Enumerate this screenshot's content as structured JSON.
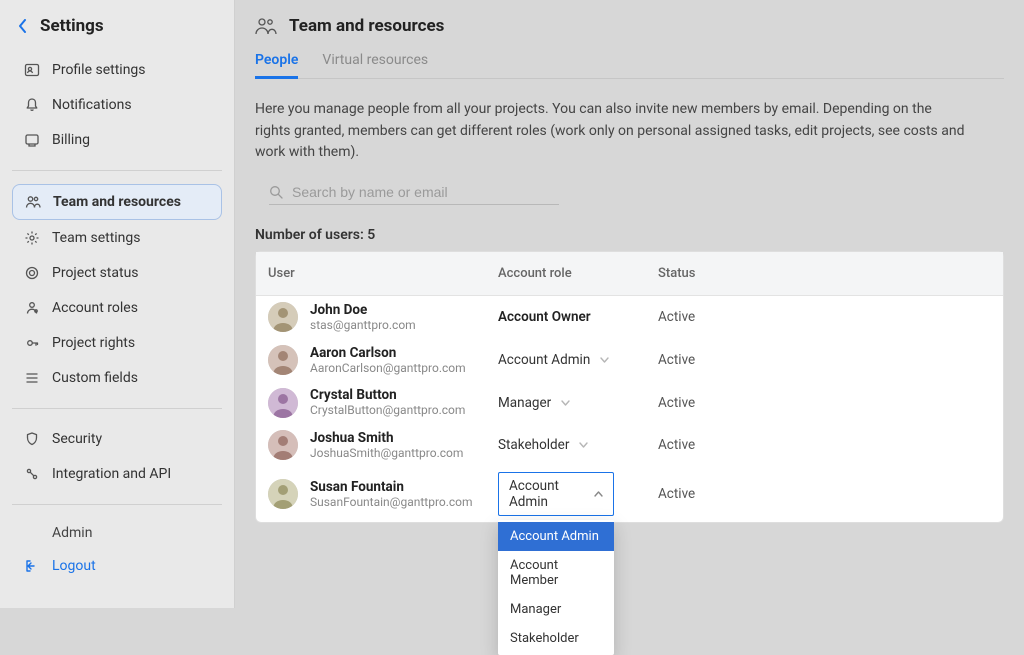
{
  "sidebar": {
    "title": "Settings",
    "items": [
      {
        "label": "Profile settings",
        "icon": "user-card-icon"
      },
      {
        "label": "Notifications",
        "icon": "bell-icon"
      },
      {
        "label": "Billing",
        "icon": "billing-icon"
      }
    ],
    "items2": [
      {
        "label": "Team and resources",
        "icon": "people-icon",
        "active": true
      },
      {
        "label": "Team settings",
        "icon": "gear-icon"
      },
      {
        "label": "Project status",
        "icon": "target-icon"
      },
      {
        "label": "Account roles",
        "icon": "roles-icon"
      },
      {
        "label": "Project rights",
        "icon": "rights-icon"
      },
      {
        "label": "Custom fields",
        "icon": "list-icon"
      }
    ],
    "items3": [
      {
        "label": "Security",
        "icon": "shield-icon"
      },
      {
        "label": "Integration and API",
        "icon": "api-icon"
      }
    ],
    "plain_label": "Admin",
    "logout": {
      "label": "Logout",
      "icon": "logout-icon"
    }
  },
  "header": {
    "title": "Team and resources",
    "icon": "people-icon"
  },
  "tabs": [
    {
      "label": "People",
      "active": true
    },
    {
      "label": "Virtual resources",
      "active": false
    }
  ],
  "intro": "Here you manage people from all your projects. You can also invite new members by email. Depending on the rights granted, members can get different roles (work only on personal assigned tasks, edit projects, see costs and work with them).",
  "search": {
    "placeholder": "Search by name or email",
    "value": ""
  },
  "usercount": {
    "label": "Number of users:",
    "value": "5"
  },
  "table": {
    "columns": {
      "user": "User",
      "role": "Account role",
      "status": "Status"
    },
    "rows": [
      {
        "name": "John Doe",
        "email": "stas@ganttpro.com",
        "role": "Account Owner",
        "editable": false,
        "open": false,
        "status": "Active"
      },
      {
        "name": "Aaron Carlson",
        "email": "AaronCarlson@ganttpro.com",
        "role": "Account Admin",
        "editable": true,
        "open": false,
        "status": "Active"
      },
      {
        "name": "Crystal Button",
        "email": "CrystalButton@ganttpro.com",
        "role": "Manager",
        "editable": true,
        "open": false,
        "status": "Active"
      },
      {
        "name": "Joshua Smith",
        "email": "JoshuaSmith@ganttpro.com",
        "role": "Stakeholder",
        "editable": true,
        "open": false,
        "status": "Active"
      },
      {
        "name": "Susan Fountain",
        "email": "SusanFountain@ganttpro.com",
        "role": "Account Admin",
        "editable": true,
        "open": true,
        "status": "Active"
      }
    ]
  },
  "role_dropdown": {
    "options": [
      "Account Admin",
      "Account Member",
      "Manager",
      "Stakeholder"
    ],
    "selected": "Account Admin"
  },
  "colors": {
    "accent": "#1a73e8",
    "sidebar_bg": "#e9e9e9",
    "main_bg": "#d7d7d7"
  }
}
